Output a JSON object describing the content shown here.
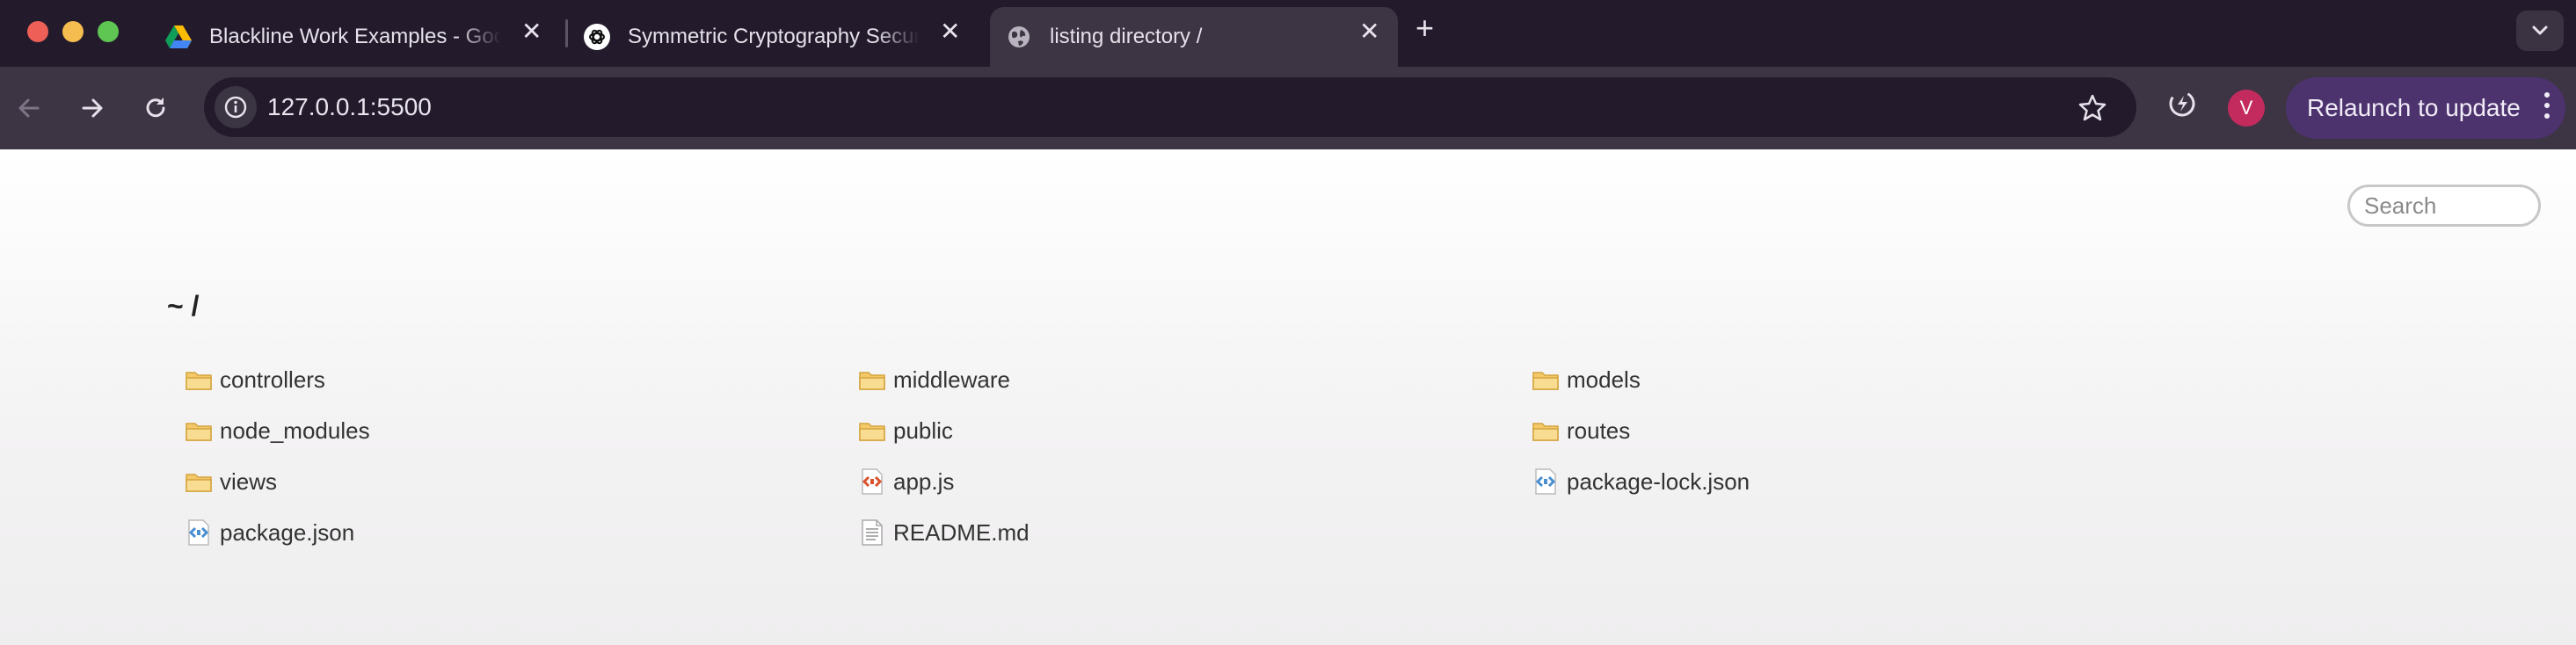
{
  "browser": {
    "tabs": [
      {
        "title": "Blackline Work Examples - Google Drive",
        "favicon": "google-drive-icon"
      },
      {
        "title": "Symmetric Cryptography Security",
        "favicon": "chatgpt-icon"
      },
      {
        "title": "listing directory /",
        "favicon": "globe-icon",
        "active": true
      }
    ],
    "url": "127.0.0.1:5500",
    "avatar_initial": "V",
    "relaunch_label": "Relaunch to update",
    "colors": {
      "tabstrip": "#231b2c",
      "toolbar": "#3d3444",
      "relaunch": "#4c336e",
      "avatar": "#c32b5e"
    }
  },
  "page": {
    "search_placeholder": "Search",
    "breadcrumb": "~ /",
    "files": [
      {
        "name": "controllers",
        "type": "folder"
      },
      {
        "name": "middleware",
        "type": "folder"
      },
      {
        "name": "models",
        "type": "folder"
      },
      {
        "name": "node_modules",
        "type": "folder"
      },
      {
        "name": "public",
        "type": "folder"
      },
      {
        "name": "routes",
        "type": "folder"
      },
      {
        "name": "views",
        "type": "folder"
      },
      {
        "name": "app.js",
        "type": "js"
      },
      {
        "name": "package-lock.json",
        "type": "json"
      },
      {
        "name": "package.json",
        "type": "json"
      },
      {
        "name": "README.md",
        "type": "text"
      }
    ]
  }
}
